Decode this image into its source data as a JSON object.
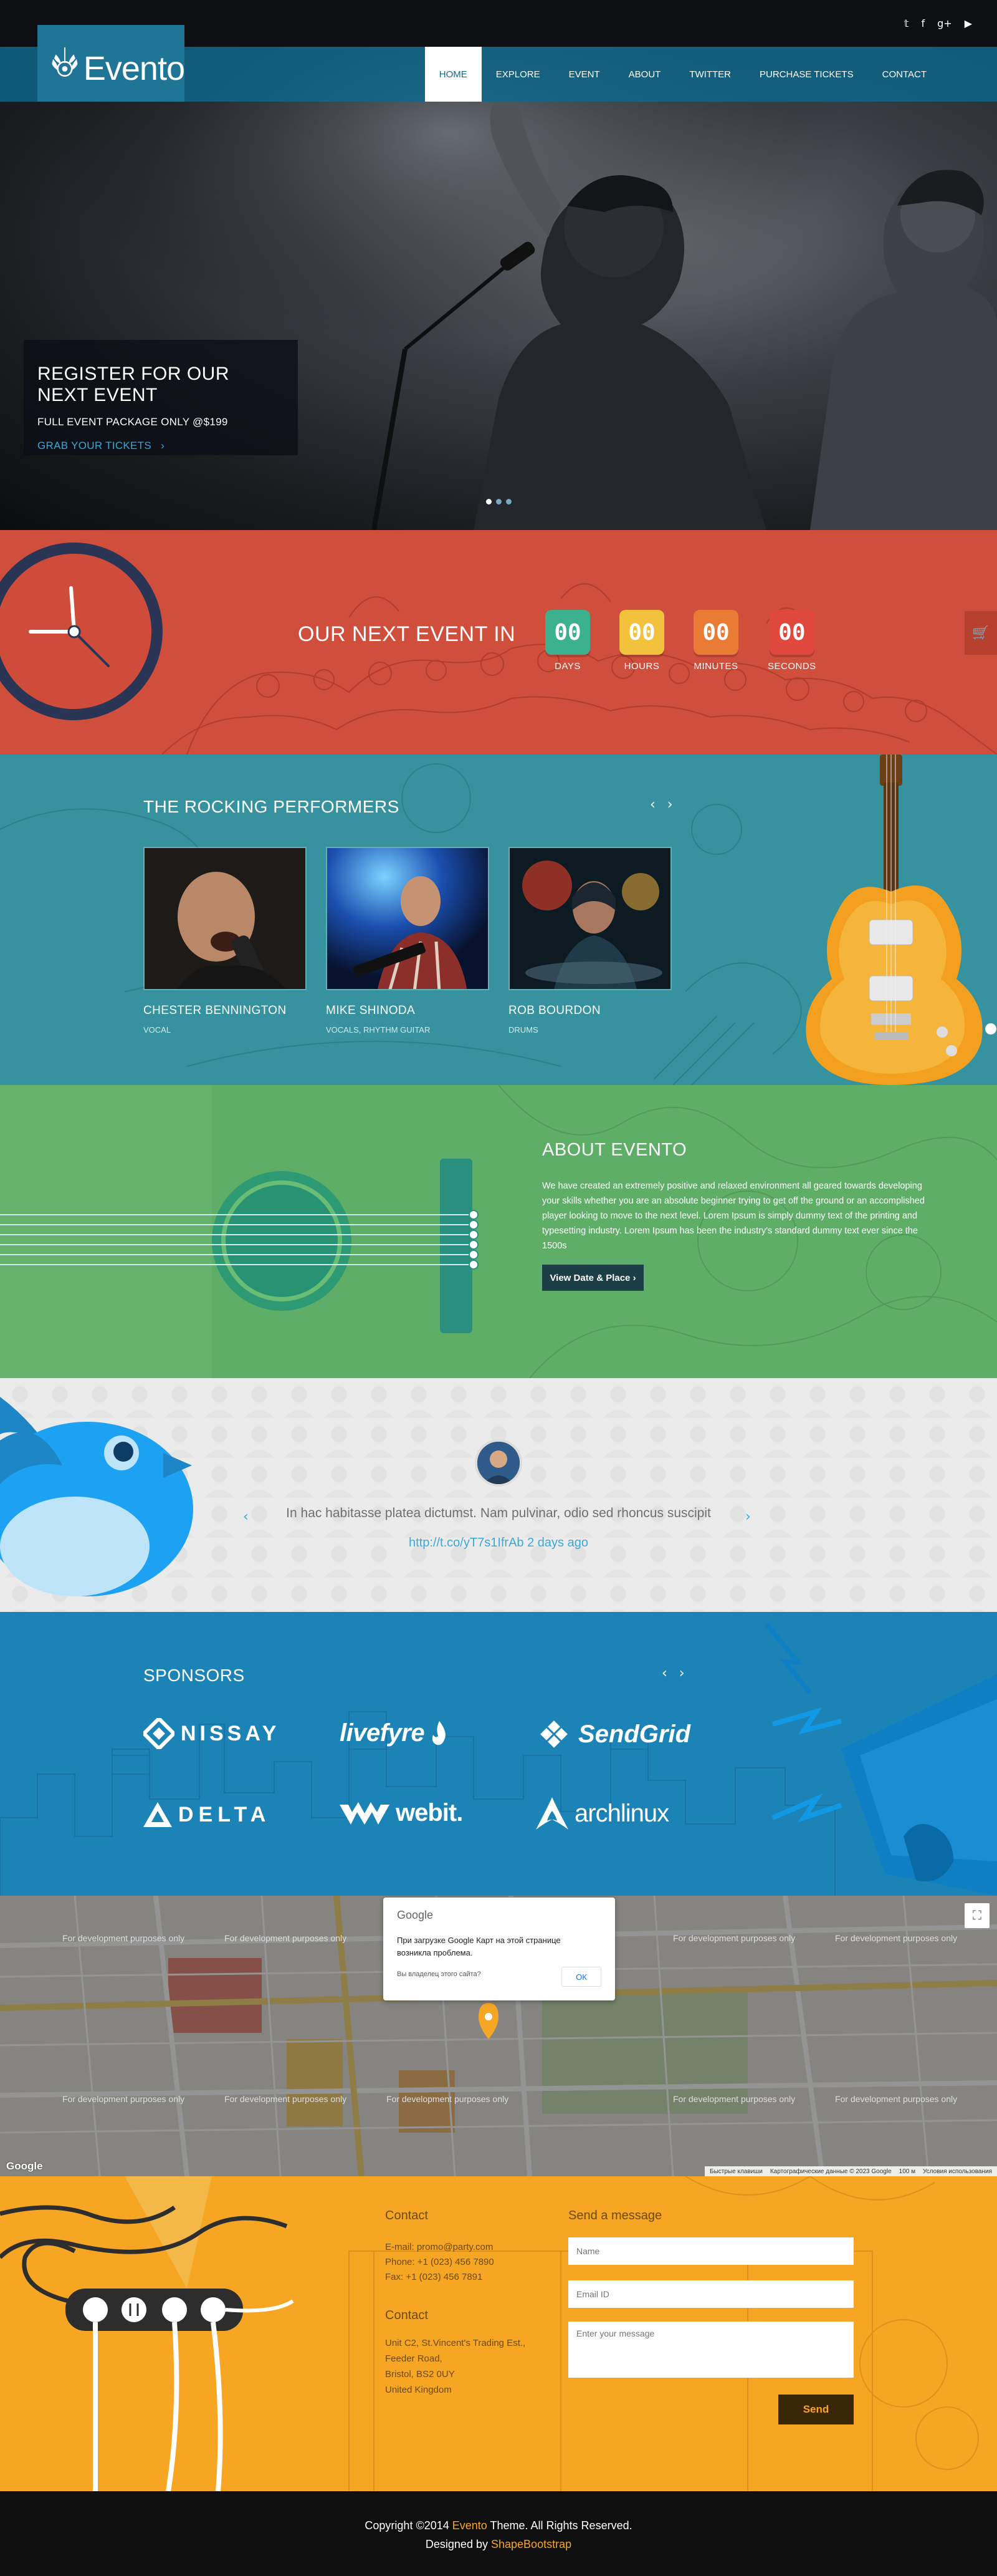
{
  "brand": {
    "name": "Evento"
  },
  "social": {
    "twitter": "𝕥",
    "facebook": "f",
    "gplus": "g+",
    "youtube": "▶"
  },
  "nav": {
    "items": [
      {
        "label": "HOME",
        "active": true
      },
      {
        "label": "EXPLORE"
      },
      {
        "label": "EVENT"
      },
      {
        "label": "ABOUT"
      },
      {
        "label": "TWITTER"
      },
      {
        "label": "PURCHASE TICKETS"
      },
      {
        "label": "CONTACT"
      }
    ]
  },
  "hero": {
    "title": "REGISTER FOR OUR NEXT EVENT",
    "subtitle": "FULL EVENT PACKAGE ONLY @$199",
    "cta": "GRAB YOUR TICKETS",
    "cta_arrow": "›"
  },
  "countdown": {
    "title": "OUR NEXT EVENT IN",
    "items": [
      {
        "value": "00",
        "label": "DAYS",
        "color": "#3bb28d"
      },
      {
        "value": "00",
        "label": "HOURS",
        "color": "#f3c23c"
      },
      {
        "value": "00",
        "label": "MINUTES",
        "color": "#e97b34"
      },
      {
        "value": "00",
        "label": "SECONDS",
        "color": "#e1483d"
      }
    ],
    "cart_icon": "🛒"
  },
  "performers": {
    "title": "THE ROCKING PERFORMERS",
    "arrows": "‹ ›",
    "items": [
      {
        "name": "CHESTER BENNINGTON",
        "role": "VOCAL"
      },
      {
        "name": "MIKE SHINODA",
        "role": "VOCALS, RHYTHM GUITAR"
      },
      {
        "name": "ROB BOURDON",
        "role": "DRUMS"
      }
    ]
  },
  "about": {
    "title": "ABOUT EVENTO",
    "text": "We have created an extremely positive and relaxed environment all geared towards developing your skills whether you are an absolute beginner trying to get off the ground or an accomplished player looking to move to the next level. Lorem Ipsum is simply dummy text of the printing and typesetting industry. Lorem Ipsum has been the industry's standard dummy text ever since the 1500s",
    "button": "View Date & Place ›"
  },
  "twitter": {
    "tweet": "In hac habitasse platea dictumst. Nam pulvinar, odio sed rhoncus suscipit",
    "link": "http://t.co/yT7s1IfrAb 2 days ago",
    "prev": "‹",
    "next": "›"
  },
  "sponsors": {
    "title": "SPONSORS",
    "arrows": "‹ ›",
    "items": [
      "NISSAY",
      "livefyre",
      "SendGrid",
      "DELTA",
      "webit.",
      "archlinux"
    ]
  },
  "map": {
    "dialog_brand": "Google",
    "dialog_message": "При загрузке Google Карт на этой странице возникла проблема.",
    "dialog_question": "Вы владелец этого сайта?",
    "dialog_ok": "ОК",
    "watermark": "For development purposes only",
    "google": "Google",
    "bar": [
      "Быстрые клавиши",
      "Картографические данные © 2023 Google",
      "100 м",
      "Условия использования"
    ]
  },
  "contact": {
    "title": "Contact",
    "email": "E-mail: promo@party.com",
    "phone": "Phone: +1 (023) 456 7890",
    "fax": "Fax: +1 (023) 456 7891",
    "title2": "Contact",
    "address": [
      "Unit C2, St.Vincent's Trading Est.,",
      "Feeder Road,",
      "Bristol, BS2 0UY",
      "United Kingdom"
    ],
    "form_title": "Send a message",
    "name_ph": "Name",
    "email_ph": "Email ID",
    "message_ph": "Enter your message",
    "send": "Send"
  },
  "footer": {
    "copy_prefix": "Copyright ©2014",
    "copy_brand": "Evento",
    "copy_suffix": "Theme. All Rights Reserved.",
    "designed_prefix": "Designed by",
    "designed_by": "ShapeBootstrap"
  }
}
